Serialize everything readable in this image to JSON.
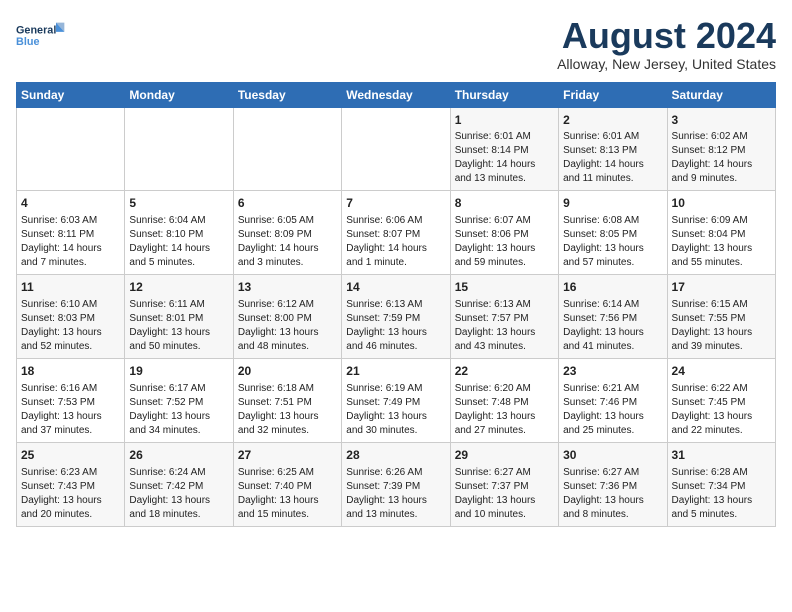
{
  "header": {
    "logo_line1": "General",
    "logo_line2": "Blue",
    "month_title": "August 2024",
    "location": "Alloway, New Jersey, United States"
  },
  "weekdays": [
    "Sunday",
    "Monday",
    "Tuesday",
    "Wednesday",
    "Thursday",
    "Friday",
    "Saturday"
  ],
  "weeks": [
    [
      {
        "day": "",
        "content": ""
      },
      {
        "day": "",
        "content": ""
      },
      {
        "day": "",
        "content": ""
      },
      {
        "day": "",
        "content": ""
      },
      {
        "day": "1",
        "content": "Sunrise: 6:01 AM\nSunset: 8:14 PM\nDaylight: 14 hours\nand 13 minutes."
      },
      {
        "day": "2",
        "content": "Sunrise: 6:01 AM\nSunset: 8:13 PM\nDaylight: 14 hours\nand 11 minutes."
      },
      {
        "day": "3",
        "content": "Sunrise: 6:02 AM\nSunset: 8:12 PM\nDaylight: 14 hours\nand 9 minutes."
      }
    ],
    [
      {
        "day": "4",
        "content": "Sunrise: 6:03 AM\nSunset: 8:11 PM\nDaylight: 14 hours\nand 7 minutes."
      },
      {
        "day": "5",
        "content": "Sunrise: 6:04 AM\nSunset: 8:10 PM\nDaylight: 14 hours\nand 5 minutes."
      },
      {
        "day": "6",
        "content": "Sunrise: 6:05 AM\nSunset: 8:09 PM\nDaylight: 14 hours\nand 3 minutes."
      },
      {
        "day": "7",
        "content": "Sunrise: 6:06 AM\nSunset: 8:07 PM\nDaylight: 14 hours\nand 1 minute."
      },
      {
        "day": "8",
        "content": "Sunrise: 6:07 AM\nSunset: 8:06 PM\nDaylight: 13 hours\nand 59 minutes."
      },
      {
        "day": "9",
        "content": "Sunrise: 6:08 AM\nSunset: 8:05 PM\nDaylight: 13 hours\nand 57 minutes."
      },
      {
        "day": "10",
        "content": "Sunrise: 6:09 AM\nSunset: 8:04 PM\nDaylight: 13 hours\nand 55 minutes."
      }
    ],
    [
      {
        "day": "11",
        "content": "Sunrise: 6:10 AM\nSunset: 8:03 PM\nDaylight: 13 hours\nand 52 minutes."
      },
      {
        "day": "12",
        "content": "Sunrise: 6:11 AM\nSunset: 8:01 PM\nDaylight: 13 hours\nand 50 minutes."
      },
      {
        "day": "13",
        "content": "Sunrise: 6:12 AM\nSunset: 8:00 PM\nDaylight: 13 hours\nand 48 minutes."
      },
      {
        "day": "14",
        "content": "Sunrise: 6:13 AM\nSunset: 7:59 PM\nDaylight: 13 hours\nand 46 minutes."
      },
      {
        "day": "15",
        "content": "Sunrise: 6:13 AM\nSunset: 7:57 PM\nDaylight: 13 hours\nand 43 minutes."
      },
      {
        "day": "16",
        "content": "Sunrise: 6:14 AM\nSunset: 7:56 PM\nDaylight: 13 hours\nand 41 minutes."
      },
      {
        "day": "17",
        "content": "Sunrise: 6:15 AM\nSunset: 7:55 PM\nDaylight: 13 hours\nand 39 minutes."
      }
    ],
    [
      {
        "day": "18",
        "content": "Sunrise: 6:16 AM\nSunset: 7:53 PM\nDaylight: 13 hours\nand 37 minutes."
      },
      {
        "day": "19",
        "content": "Sunrise: 6:17 AM\nSunset: 7:52 PM\nDaylight: 13 hours\nand 34 minutes."
      },
      {
        "day": "20",
        "content": "Sunrise: 6:18 AM\nSunset: 7:51 PM\nDaylight: 13 hours\nand 32 minutes."
      },
      {
        "day": "21",
        "content": "Sunrise: 6:19 AM\nSunset: 7:49 PM\nDaylight: 13 hours\nand 30 minutes."
      },
      {
        "day": "22",
        "content": "Sunrise: 6:20 AM\nSunset: 7:48 PM\nDaylight: 13 hours\nand 27 minutes."
      },
      {
        "day": "23",
        "content": "Sunrise: 6:21 AM\nSunset: 7:46 PM\nDaylight: 13 hours\nand 25 minutes."
      },
      {
        "day": "24",
        "content": "Sunrise: 6:22 AM\nSunset: 7:45 PM\nDaylight: 13 hours\nand 22 minutes."
      }
    ],
    [
      {
        "day": "25",
        "content": "Sunrise: 6:23 AM\nSunset: 7:43 PM\nDaylight: 13 hours\nand 20 minutes."
      },
      {
        "day": "26",
        "content": "Sunrise: 6:24 AM\nSunset: 7:42 PM\nDaylight: 13 hours\nand 18 minutes."
      },
      {
        "day": "27",
        "content": "Sunrise: 6:25 AM\nSunset: 7:40 PM\nDaylight: 13 hours\nand 15 minutes."
      },
      {
        "day": "28",
        "content": "Sunrise: 6:26 AM\nSunset: 7:39 PM\nDaylight: 13 hours\nand 13 minutes."
      },
      {
        "day": "29",
        "content": "Sunrise: 6:27 AM\nSunset: 7:37 PM\nDaylight: 13 hours\nand 10 minutes."
      },
      {
        "day": "30",
        "content": "Sunrise: 6:27 AM\nSunset: 7:36 PM\nDaylight: 13 hours\nand 8 minutes."
      },
      {
        "day": "31",
        "content": "Sunrise: 6:28 AM\nSunset: 7:34 PM\nDaylight: 13 hours\nand 5 minutes."
      }
    ]
  ]
}
